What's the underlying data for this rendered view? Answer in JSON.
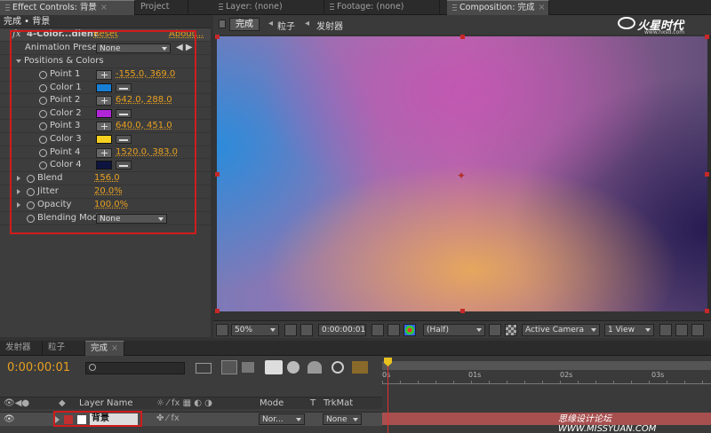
{
  "tabs_top": {
    "effect_controls": "Effect Controls: 背景",
    "project": "Project",
    "layer": "Layer: (none)",
    "footage": "Footage: (none)",
    "composition": "Composition: 完成"
  },
  "effect_panel": {
    "breadcrumb": "完成 • 背景",
    "fx_label": "fx",
    "effect_name": "4-Color...dient",
    "reset": "Reset",
    "about": "About...",
    "animation_presets_label": "Animation Presets",
    "animation_presets_value": "None",
    "positions_colors": "Positions & Colors",
    "props": [
      {
        "label": "Point 1",
        "value": "-155.0, 369.0"
      },
      {
        "label": "Color 1",
        "color": "#1a7fd4"
      },
      {
        "label": "Point 2",
        "value": "642.0, 288.0"
      },
      {
        "label": "Color 2",
        "color": "#b026d6"
      },
      {
        "label": "Point 3",
        "value": "640.0, 451.0"
      },
      {
        "label": "Color 3",
        "color": "#f5d020"
      },
      {
        "label": "Point 4",
        "value": "1520.0, 383.0"
      },
      {
        "label": "Color 4",
        "color": "#0d1440"
      }
    ],
    "blend_label": "Blend",
    "blend_value": "156.0",
    "jitter_label": "Jitter",
    "jitter_value": "20.0%",
    "opacity_label": "Opacity",
    "opacity_value": "100.0%",
    "blending_mode_label": "Blending Mod",
    "blending_mode_value": "None"
  },
  "comp_nav": {
    "item1": "完成",
    "item2": "粒子",
    "item3": "发射器"
  },
  "logo": {
    "brand": "火星时代",
    "url": "www.hxsd.com"
  },
  "comp_bottom": {
    "zoom": "50%",
    "timecode": "0:00:00:01",
    "resolution": "(Half)",
    "camera": "Active Camera",
    "view": "1 View"
  },
  "timeline": {
    "tabs": [
      "发射器",
      "粒子",
      "完成"
    ],
    "current_time": "0:00:00:01",
    "ruler": [
      "0s",
      "01s",
      "02s",
      "03s"
    ],
    "col_layer_name": "Layer Name",
    "col_mode": "Mode",
    "col_t": "T",
    "col_trkmat": "TrkMat",
    "layer_name": "背景",
    "layer_mode": "Nor...",
    "layer_trkmat": "None"
  },
  "watermark": "思缘设计论坛 WWW.MISSYUAN.COM",
  "colors": {
    "accent": "#e8a020",
    "highlight": "#d01c1c"
  }
}
